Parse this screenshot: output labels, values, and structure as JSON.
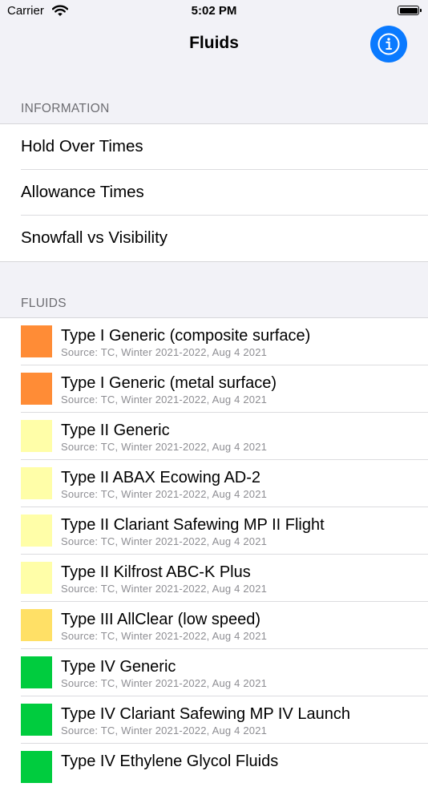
{
  "status_bar": {
    "carrier": "Carrier",
    "time": "5:02 PM"
  },
  "nav": {
    "title": "Fluids",
    "info_icon": "info-icon"
  },
  "information": {
    "header": "INFORMATION",
    "items": [
      {
        "label": "Hold Over Times"
      },
      {
        "label": "Allowance Times"
      },
      {
        "label": "Snowfall vs Visibility"
      }
    ]
  },
  "fluids": {
    "header": "FLUIDS",
    "items": [
      {
        "title": "Type I Generic (composite surface)",
        "source": "Source: TC, Winter 2021-2022, Aug 4 2021",
        "color": "#ff8c36"
      },
      {
        "title": "Type I Generic (metal surface)",
        "source": "Source: TC, Winter 2021-2022, Aug 4 2021",
        "color": "#ff8c36"
      },
      {
        "title": "Type II Generic",
        "source": "Source: TC, Winter 2021-2022, Aug 4 2021",
        "color": "#fffea8"
      },
      {
        "title": "Type II ABAX Ecowing AD-2",
        "source": "Source: TC, Winter 2021-2022, Aug 4 2021",
        "color": "#fffea8"
      },
      {
        "title": "Type II Clariant Safewing MP II Flight",
        "source": "Source: TC, Winter 2021-2022, Aug 4 2021",
        "color": "#fffea8"
      },
      {
        "title": "Type II Kilfrost ABC-K Plus",
        "source": "Source: TC, Winter 2021-2022, Aug 4 2021",
        "color": "#fffea8"
      },
      {
        "title": "Type III AllClear (low speed)",
        "source": "Source: TC, Winter 2021-2022, Aug 4 2021",
        "color": "#ffe066"
      },
      {
        "title": "Type IV Generic",
        "source": "Source: TC, Winter 2021-2022, Aug 4 2021",
        "color": "#00cc3e"
      },
      {
        "title": "Type IV Clariant Safewing MP IV Launch",
        "source": "Source: TC, Winter 2021-2022, Aug 4 2021",
        "color": "#00cc3e"
      },
      {
        "title": "Type IV Ethylene Glycol Fluids",
        "source": "",
        "color": "#00cc3e"
      }
    ]
  }
}
